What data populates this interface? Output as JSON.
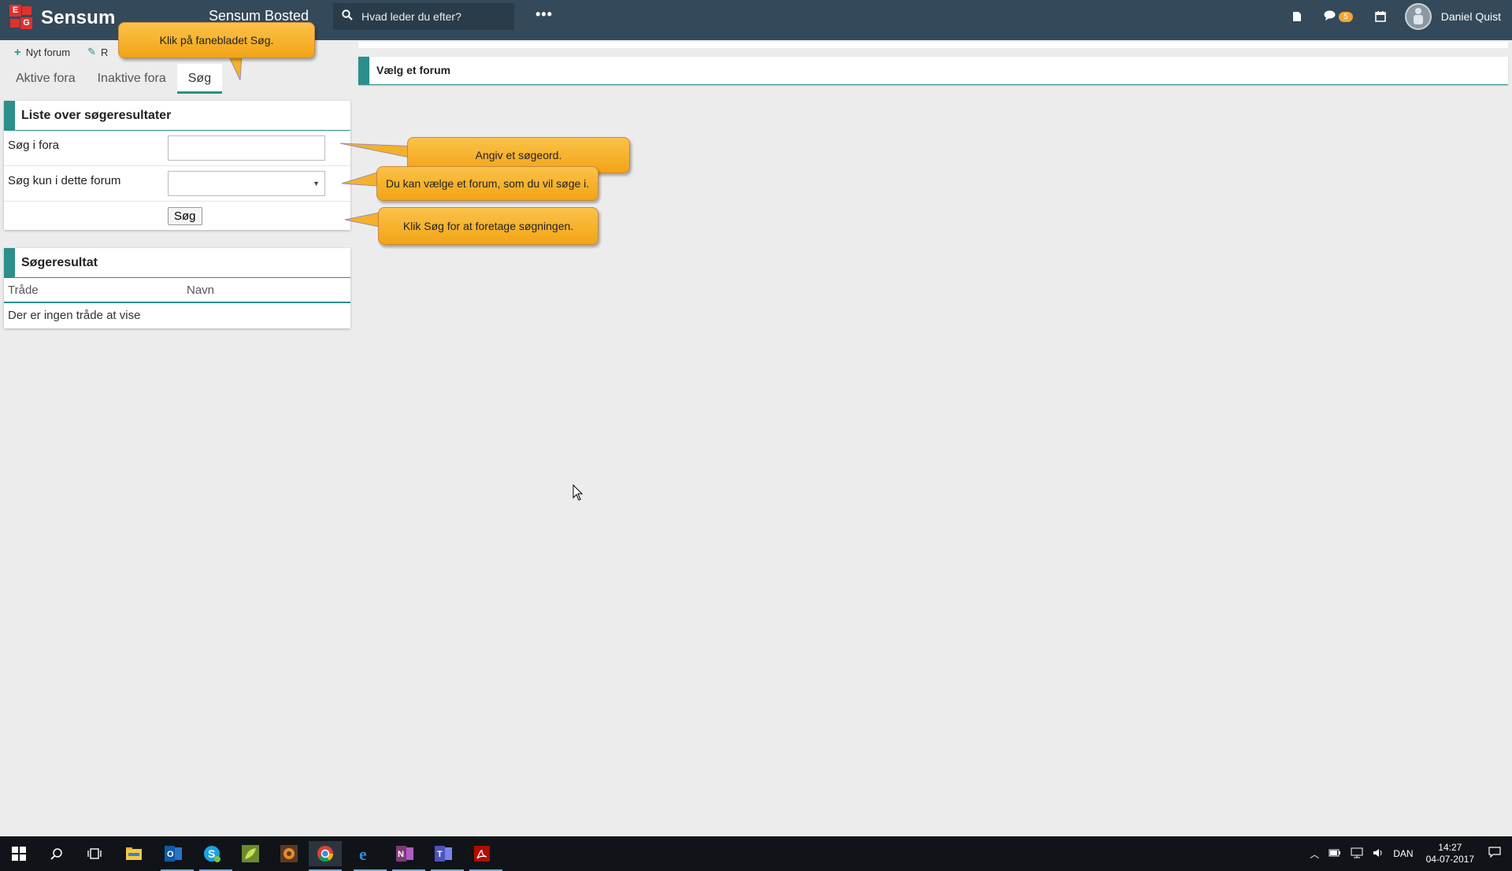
{
  "topbar": {
    "logo_letter_e": "E",
    "logo_letter_g": "G",
    "brand": "Sensum",
    "app_title": "Sensum Bosted",
    "search_placeholder": "Hvad leder du efter?",
    "more": "•••",
    "notifications_count": "5",
    "user_name": "Daniel Quist"
  },
  "toolbar": {
    "new_forum": "Nyt forum",
    "edit_partial": "R"
  },
  "tabs": {
    "active": "Aktive fora",
    "inactive": "Inaktive fora",
    "search": "Søg"
  },
  "search_card": {
    "title": "Liste over søgeresultater",
    "label_search": "Søg i fora",
    "label_forum": "Søg kun i dette forum",
    "search_value": "",
    "forum_value": "",
    "button": "Søg"
  },
  "results_card": {
    "title": "Søgeresultat",
    "col_thread": "Tråde",
    "col_name": "Navn",
    "empty": "Der er ingen tråde at vise"
  },
  "right_panel": {
    "title": "Vælg et forum"
  },
  "callouts": {
    "tab": "Klik på fanebladet Søg.",
    "keyword": "Angiv et søgeord.",
    "forum": "Du kan vælge et forum, som du vil søge i.",
    "button": "Klik Søg for at foretage søgningen."
  },
  "taskbar": {
    "language": "DAN",
    "time": "14:27",
    "date": "04-07-2017"
  },
  "colors": {
    "topbar": "#34495a",
    "accent": "#2b8f8c",
    "callout": "#f2a415"
  }
}
